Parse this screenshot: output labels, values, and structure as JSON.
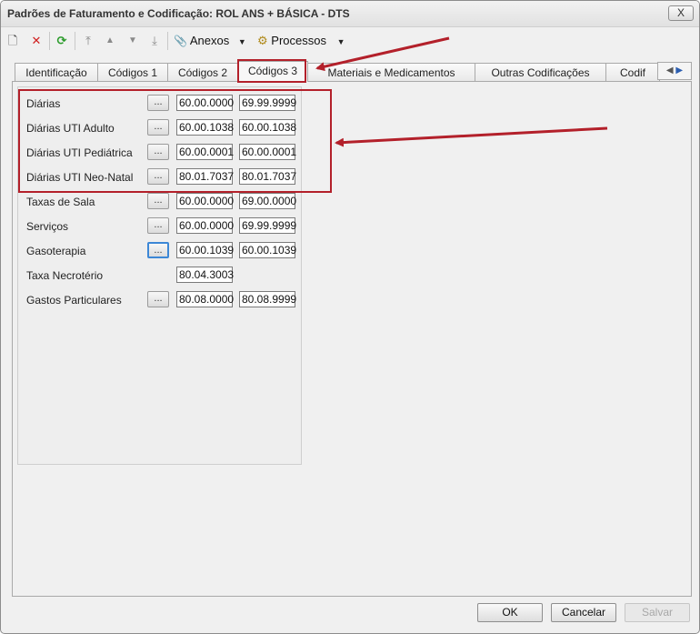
{
  "window": {
    "title": "Padrões de Faturamento e Codificação: ROL ANS + BÁSICA - DTS",
    "close_label": "X"
  },
  "toolbar": {
    "new_icon": "🗋",
    "delete_icon": "✕",
    "refresh_icon": "⟳",
    "first_icon": "⤒",
    "prev_icon": "▲",
    "next_icon": "▼",
    "last_icon": "⤓",
    "attach_icon": "📎",
    "anexos_label": "Anexos",
    "process_icon": "⚙",
    "processos_label": "Processos",
    "caret": "▼"
  },
  "tabs": [
    {
      "label": "Identificação"
    },
    {
      "label": "Códigos 1"
    },
    {
      "label": "Códigos 2"
    },
    {
      "label": "Códigos 3"
    },
    {
      "label": "Materiais e Medicamentos"
    },
    {
      "label": "Outras Codificações"
    },
    {
      "label": "Codif"
    }
  ],
  "tab_scroll": {
    "left": "◀",
    "right": "▶"
  },
  "rows": [
    {
      "label": "Diárias",
      "has_button": true,
      "from": "60.00.0000",
      "to": "69.99.9999"
    },
    {
      "label": "Diárias UTI Adulto",
      "has_button": true,
      "from": "60.00.1038",
      "to": "60.00.1038"
    },
    {
      "label": "Diárias UTI Pediátrica",
      "has_button": true,
      "from": "60.00.0001",
      "to": "60.00.0001"
    },
    {
      "label": "Diárias UTI Neo-Natal",
      "has_button": true,
      "from": "80.01.7037",
      "to": "80.01.7037"
    },
    {
      "label": "Taxas de Sala",
      "has_button": true,
      "from": "60.00.0000",
      "to": "69.00.0000"
    },
    {
      "label": "Serviços",
      "has_button": true,
      "from": "60.00.0000",
      "to": "69.99.9999"
    },
    {
      "label": "Gasoterapia",
      "has_button": true,
      "from": "60.00.1039",
      "to": "60.00.1039"
    },
    {
      "label": "Taxa Necrotério",
      "has_button": false,
      "from": "80.04.3003",
      "to": ""
    },
    {
      "label": "Gastos Particulares",
      "has_button": true,
      "from": "80.08.0000",
      "to": "80.08.9999"
    }
  ],
  "ellipsis_label": "...",
  "buttons": {
    "ok": "OK",
    "cancel": "Cancelar",
    "save": "Salvar"
  },
  "colors": {
    "annotation": "#b3202a",
    "focus": "#3c87d6"
  }
}
